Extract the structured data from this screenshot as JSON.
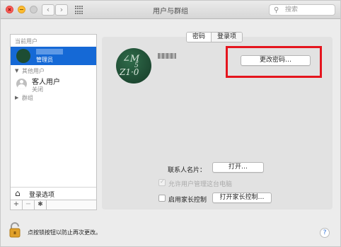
{
  "window": {
    "title": "用户与群组"
  },
  "toolbar": {
    "back_glyph": "‹",
    "forward_glyph": "›"
  },
  "search": {
    "placeholder": "搜索"
  },
  "sidebar": {
    "current_users_header": "当前用户",
    "current_user_role": "管理员",
    "other_users_header": "其他用户",
    "guest": {
      "name": "客人用户",
      "status": "关闭"
    },
    "groups_header": "群组",
    "login_options": "登录选项",
    "add_glyph": "+",
    "remove_glyph": "−",
    "gear_glyph": "✱"
  },
  "tabs": [
    {
      "label": "密码",
      "active": true
    },
    {
      "label": "登录项",
      "active": false
    }
  ],
  "main": {
    "change_password_button": "更改密码…",
    "contact_card_label": "联系人名片：",
    "open_button": "打开…",
    "allow_admin_label": "允许用户管理这台电脑",
    "parental_controls_label": "启用家长控制",
    "open_parental_button": "打开家长控制…"
  },
  "footer": {
    "lock_text": "点按锁按钮以防止再次更改。",
    "help": "?"
  },
  "colors": {
    "selection": "#1569d6",
    "highlight_box": "#e5151e",
    "avatar_green": "#1d4d33"
  }
}
